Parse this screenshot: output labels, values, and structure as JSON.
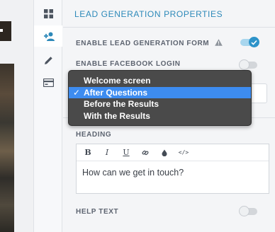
{
  "panel": {
    "title": "LEAD GENERATION PROPERTIES",
    "enable_form_label": "ENABLE LEAD GENERATION FORM",
    "enable_form_on": true,
    "facebook_login_label": "ENABLE FACEBOOK LOGIN",
    "facebook_login_on": false,
    "heading_label": "HEADING",
    "heading_text": "How can we get in touch?",
    "help_text_label": "HELP TEXT",
    "help_text_on": false
  },
  "editor_toolbar": {
    "bold": "B",
    "italic": "I",
    "underline": "U",
    "link_icon": "link-icon",
    "color_icon": "color-drop-icon",
    "code": "</>"
  },
  "toolbar_icons": [
    "grid-icon",
    "add-user-icon",
    "pencil-icon",
    "card-icon"
  ],
  "dropdown": {
    "options": [
      "Welcome screen",
      "After Questions",
      "Before the Results",
      "With the Results"
    ],
    "selected": "After Questions"
  },
  "colors": {
    "accent": "#2d89b9",
    "toggle_on": "#2d93c9",
    "selection": "#3d8cf0",
    "menu_bg": "#4a4a4a"
  }
}
